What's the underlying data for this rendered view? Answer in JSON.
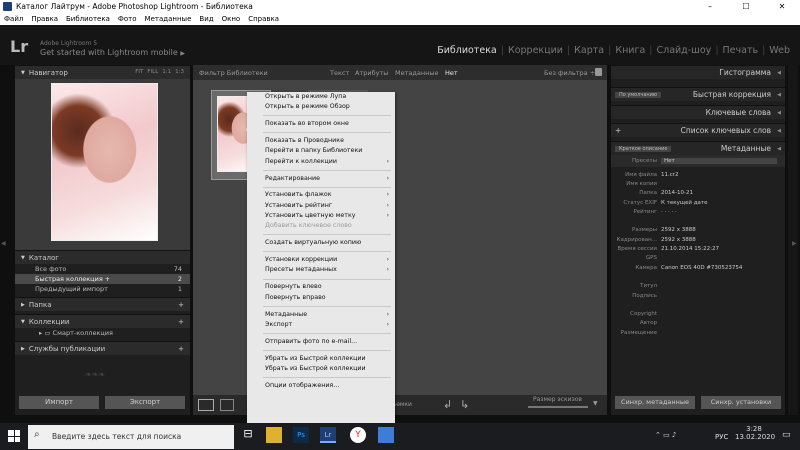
{
  "window": {
    "title": "Каталог Лайтрум - Adobe Photoshop Lightroom - Библиотека",
    "min": "–",
    "max": "☐",
    "close": "✕"
  },
  "menubar": [
    "Файл",
    "Правка",
    "Библиотека",
    "Фото",
    "Метаданные",
    "Вид",
    "Окно",
    "Справка"
  ],
  "identity": {
    "logo": "Lr",
    "product": "Adobe Lightroom 5",
    "tagline": "Get started with Lightroom mobile",
    "arrow": "▶"
  },
  "modules": [
    "Библиотека",
    "Коррекции",
    "Карта",
    "Книга",
    "Слайд-шоу",
    "Печать",
    "Web"
  ],
  "left": {
    "navigator": "Навигатор",
    "nav_opts": [
      "FIT",
      "FILL",
      "1:1",
      "1:3"
    ],
    "catalog": "Каталог",
    "catalog_items": [
      {
        "label": "Все фото",
        "count": "74"
      },
      {
        "label": "Быстрая коллекция +",
        "count": "2"
      },
      {
        "label": "Предыдущий импорт",
        "count": "1"
      }
    ],
    "folders": "Папка",
    "collections": "Коллекции",
    "smart_collection": "Смарт-коллекция",
    "publish": "Службы публикации",
    "import_btn": "Импорт",
    "export_btn": "Экспорт"
  },
  "filterbar": {
    "title": "Фильтр Библиотеки",
    "tabs": [
      "Текст",
      "Атрибуты",
      "Метаданные",
      "Нет"
    ],
    "nofilter": "Без фильтра ÷"
  },
  "toolbar": {
    "sort": "Время съемки",
    "thumb_size": "Размер эскизов"
  },
  "context_menu": [
    {
      "label": "Открыть в режиме Лупа"
    },
    {
      "label": "Открыть в режиме Обзор"
    },
    {
      "sep": true
    },
    {
      "label": "Показать во втором окне"
    },
    {
      "sep": true
    },
    {
      "label": "Показать в Проводнике"
    },
    {
      "label": "Перейти в папку Библиотеки"
    },
    {
      "label": "Перейти к коллекции",
      "sub": true
    },
    {
      "sep": true
    },
    {
      "label": "Редактирование",
      "sub": true
    },
    {
      "sep": true
    },
    {
      "label": "Установить флажок",
      "sub": true
    },
    {
      "label": "Установить рейтинг",
      "sub": true
    },
    {
      "label": "Установить цветную метку",
      "sub": true
    },
    {
      "label": "Добавить ключевое слово",
      "disabled": true
    },
    {
      "sep": true
    },
    {
      "label": "Создать виртуальную копию"
    },
    {
      "sep": true
    },
    {
      "label": "Установки коррекции",
      "sub": true
    },
    {
      "label": "Пресеты метаданных",
      "sub": true
    },
    {
      "sep": true
    },
    {
      "label": "Повернуть влево"
    },
    {
      "label": "Повернуть вправо"
    },
    {
      "sep": true
    },
    {
      "label": "Метаданные",
      "sub": true
    },
    {
      "label": "Экспорт",
      "sub": true
    },
    {
      "sep": true
    },
    {
      "label": "Отправить фото по e-mail..."
    },
    {
      "sep": true
    },
    {
      "label": "Убрать из Быстрой коллекции"
    },
    {
      "label": "Убрать из Быстрой коллекции"
    },
    {
      "sep": true
    },
    {
      "label": "Опции отображения..."
    }
  ],
  "right": {
    "histogram": "Гистограмма",
    "default_preset": "По умолчанию",
    "quick_develop": "Быстрая коррекция",
    "keywording": "Ключевые слова",
    "keyword_list": "Список ключевых слов",
    "short_desc": "Краткое описание",
    "metadata": "Метаданные",
    "preset_label": "Пресеты",
    "preset_value": "Нет",
    "meta": [
      {
        "k": "Имя файла",
        "v": "11.cr2"
      },
      {
        "k": "Имя копии",
        "v": ""
      },
      {
        "k": "Папка",
        "v": "2014-10-21"
      },
      {
        "k": "Статус EXIF",
        "v": "К текущей дате"
      },
      {
        "k": "Рейтинг",
        "v": "· · · · ·"
      },
      {
        "k": "",
        "v": ""
      },
      {
        "k": "Размеры",
        "v": "2592 x 3888"
      },
      {
        "k": "Кадрирован...",
        "v": "2592 x 3888"
      },
      {
        "k": "Время сессии",
        "v": "21.10.2014 15:22:27"
      },
      {
        "k": "GPS",
        "v": ""
      },
      {
        "k": "Камера",
        "v": "Canon EOS 40D #730523754"
      },
      {
        "k": "",
        "v": ""
      },
      {
        "k": "Титул",
        "v": ""
      },
      {
        "k": "Подпись",
        "v": ""
      },
      {
        "k": "",
        "v": ""
      },
      {
        "k": "Copyright",
        "v": ""
      },
      {
        "k": "Автор",
        "v": ""
      },
      {
        "k": "Размещение",
        "v": ""
      }
    ],
    "sync_meta": "Синхр. метаданные",
    "sync_settings": "Синхр. установки"
  },
  "taskbar": {
    "search": "Введите здесь текст для поиска",
    "lang": "РУС",
    "time": "3:28",
    "date": "13.02.2020"
  }
}
